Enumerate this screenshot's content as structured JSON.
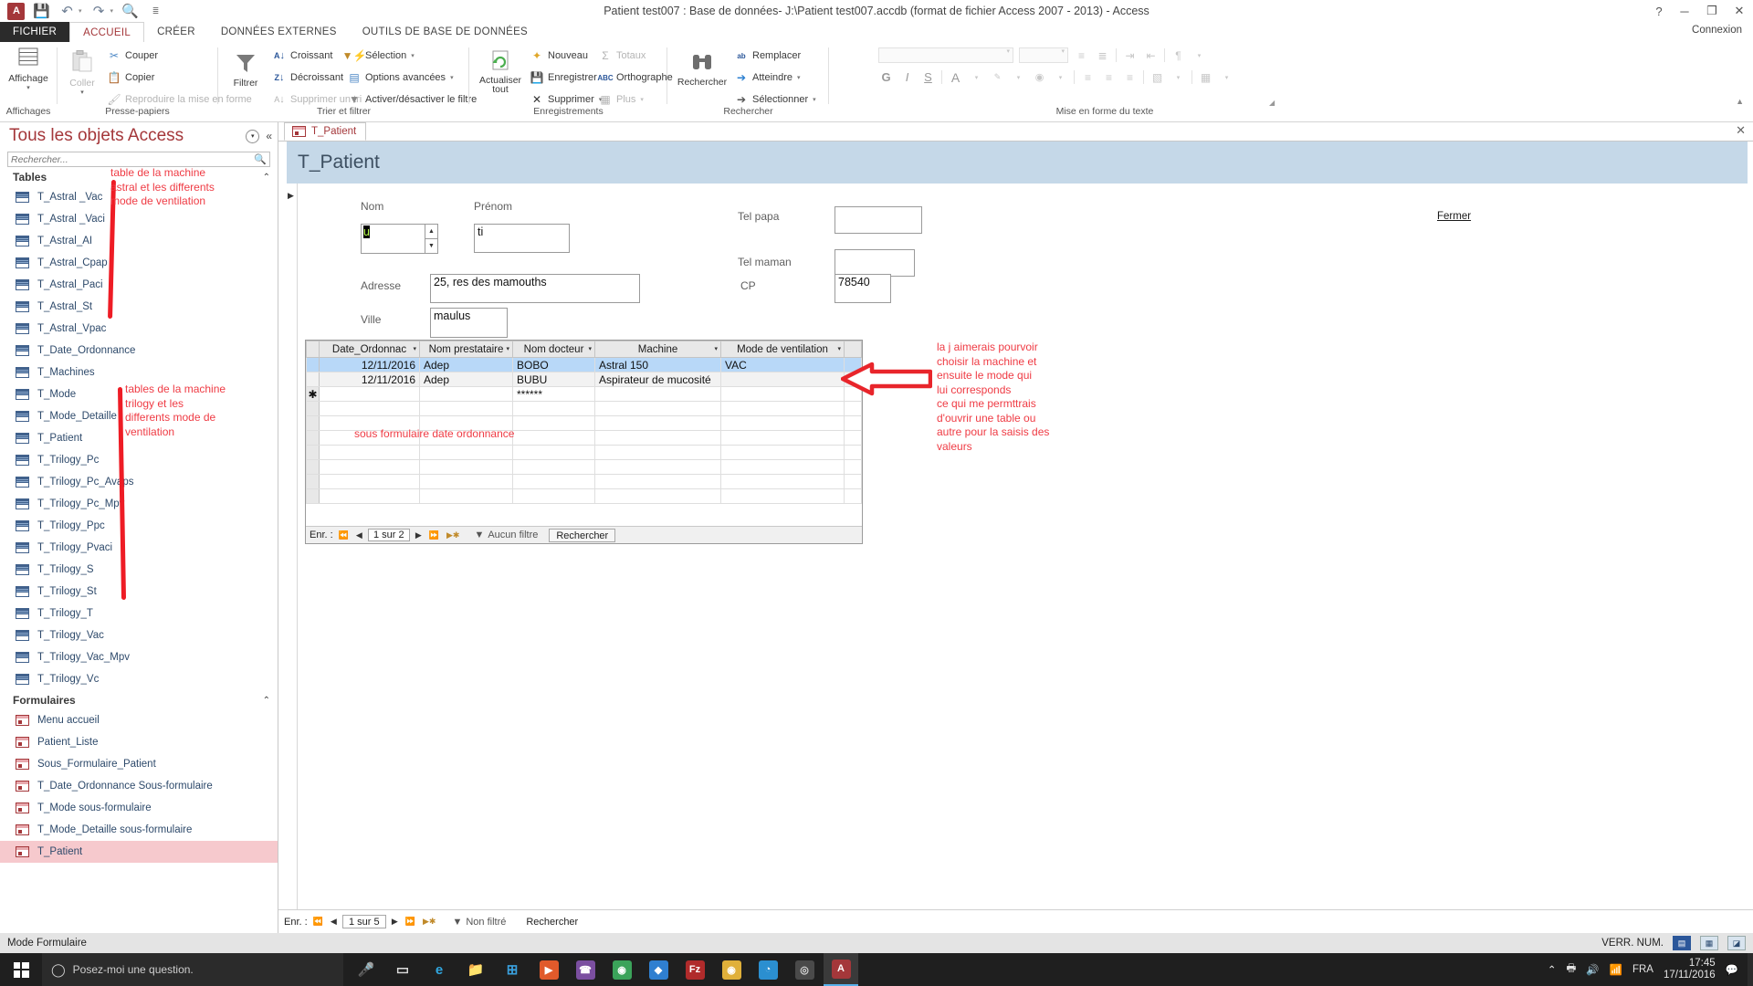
{
  "titlebar": {
    "document_title": "Patient test007 : Base de données- J:\\Patient test007.accdb (format de fichier Access 2007 - 2013) - Access",
    "qat": [
      {
        "name": "access-app-icon",
        "glyph": "A"
      },
      {
        "name": "save-icon",
        "glyph": "💾"
      },
      {
        "name": "undo-icon",
        "glyph": "↶"
      },
      {
        "name": "redo-icon",
        "glyph": "↷"
      },
      {
        "name": "print-preview-icon",
        "glyph": "🔍"
      },
      {
        "name": "customize-qat-icon",
        "glyph": "▾"
      }
    ],
    "window_controls": {
      "help": "?",
      "minimize": "─",
      "restore": "❐",
      "close": "✕"
    }
  },
  "ribbon": {
    "tabs": [
      {
        "label": "FICHIER",
        "active": false,
        "file": true
      },
      {
        "label": "ACCUEIL",
        "active": true
      },
      {
        "label": "CRÉER",
        "active": false
      },
      {
        "label": "DONNÉES EXTERNES",
        "active": false
      },
      {
        "label": "OUTILS DE BASE DE DONNÉES",
        "active": false
      }
    ],
    "connexion": "Connexion",
    "groups": [
      {
        "name": "affichages",
        "label": "Affichages"
      },
      {
        "name": "presse-papiers",
        "label": "Presse-papiers"
      },
      {
        "name": "trier-et-filtrer",
        "label": "Trier et filtrer"
      },
      {
        "name": "enregistrements",
        "label": "Enregistrements"
      },
      {
        "name": "rechercher",
        "label": "Rechercher"
      },
      {
        "name": "mise-en-forme-du-texte",
        "label": "Mise en forme du texte"
      }
    ],
    "affichage": {
      "label": "Affichage",
      "caret": "▾"
    },
    "clipboard": {
      "coller": "Coller",
      "couper": "Couper",
      "copier": "Copier",
      "reproduire": "Reproduire la mise en forme"
    },
    "filtrer": {
      "label": "Filtrer"
    },
    "tri": {
      "croissant": "Croissant",
      "decroissant": "Décroissant",
      "supprimer_tri": "Supprimer un tri",
      "selection": "Sélection",
      "options_avancees": "Options avancées",
      "activer_filtre": "Activer/désactiver le filtre"
    },
    "enregistrements": {
      "actualiser_tout": "Actualiser tout",
      "nouveau": "Nouveau",
      "enregistrer": "Enregistrer",
      "supprimer": "Supprimer",
      "totaux": "Totaux",
      "orthographe": "Orthographe",
      "plus": "Plus"
    },
    "rechercher_group": {
      "rechercher": "Rechercher",
      "remplacer": "Remplacer",
      "atteindre": "Atteindre",
      "selectionner": "Sélectionner"
    },
    "mise_en_forme": {
      "font_name": "",
      "font_size": "",
      "gras": "G",
      "italique": "I",
      "souligne": "S",
      "couleur_police": "A",
      "surlignage": "ab",
      "remplissage": "◆"
    }
  },
  "navpane": {
    "title": "Tous les objets Access",
    "search_placeholder": "Rechercher...",
    "groups": [
      {
        "name": "Tables",
        "collapse_glyph": "⌃",
        "items": [
          "T_Astral _Vac",
          "T_Astral _Vaci",
          "T_Astral_AI",
          "T_Astral_Cpap",
          "T_Astral_Paci",
          "T_Astral_St",
          "T_Astral_Vpac",
          "T_Date_Ordonnance",
          "T_Machines",
          "T_Mode",
          "T_Mode_Detaille",
          "T_Patient",
          "T_Trilogy_Pc",
          "T_Trilogy_Pc_Avaps",
          "T_Trilogy_Pc_Mpv",
          "T_Trilogy_Ppc",
          "T_Trilogy_Pvaci",
          "T_Trilogy_S",
          "T_Trilogy_St",
          "T_Trilogy_T",
          "T_Trilogy_Vac",
          "T_Trilogy_Vac_Mpv",
          "T_Trilogy_Vc"
        ]
      },
      {
        "name": "Formulaires",
        "collapse_glyph": "⌃",
        "items": [
          "Menu accueil",
          "Patient_Liste",
          "Sous_Formulaire_Patient",
          "T_Date_Ordonnance Sous-formulaire",
          "T_Mode sous-formulaire",
          "T_Mode_Detaille sous-formulaire",
          "T_Patient"
        ],
        "selected": "T_Patient"
      }
    ]
  },
  "document": {
    "tab_label": "T_Patient",
    "close_glyph": "✕",
    "form_title": "T_Patient",
    "fermer_label": "Fermer",
    "fields": [
      {
        "name": "nom",
        "label": "Nom",
        "value": "u"
      },
      {
        "name": "prenom",
        "label": "Prénom",
        "value": "ti"
      },
      {
        "name": "tel-papa",
        "label": "Tel papa",
        "value": ""
      },
      {
        "name": "tel-maman",
        "label": "Tel maman",
        "value": ""
      },
      {
        "name": "adresse",
        "label": "Adresse",
        "value": "25, res des mamouths"
      },
      {
        "name": "cp",
        "label": "CP",
        "value": "78540"
      },
      {
        "name": "ville",
        "label": "Ville",
        "value": "maulus"
      }
    ],
    "datasheet": {
      "columns": [
        "Date_Ordonnac",
        "Nom prestataire",
        "Nom docteur",
        "Machine",
        "Mode de ventilation"
      ],
      "rows": [
        {
          "selected": true,
          "cells": [
            "12/11/2016",
            "Adep",
            "BOBO",
            "Astral 150",
            "VAC"
          ]
        },
        {
          "selected": false,
          "cells": [
            "12/11/2016",
            "Adep",
            "BUBU",
            "Aspirateur de mucosité",
            ""
          ]
        },
        {
          "newrow": true,
          "cells": [
            "",
            "",
            "******",
            "",
            ""
          ]
        }
      ],
      "nav": {
        "prefix": "Enr. :",
        "position": "1 sur 2",
        "filter_label": "Aucun filtre",
        "search_label": "Rechercher"
      }
    },
    "form_nav": {
      "prefix": "Enr. :",
      "position": "1 sur 5",
      "filter_label": "Non filtré",
      "search_label": "Rechercher"
    }
  },
  "annotations": [
    {
      "name": "annot-astral",
      "text": "table de la machine\nastral et les differents\nmode de ventilation"
    },
    {
      "name": "annot-trilogy",
      "text": "tables de la machine\ntrilogy et les\ndifferents mode de\nventilation"
    },
    {
      "name": "annot-sousformulaire",
      "text": "sous formulaire date ordonnance"
    },
    {
      "name": "annot-wish",
      "text": "la j aimerais pourvoir\nchoisir la machine et\nensuite le mode qui\nlui corresponds\nce qui me permttrais\nd'ouvrir une table ou\nautre pour la saisis des\nvaleurs"
    }
  ],
  "statusbar": {
    "mode": "Mode Formulaire",
    "numlock": "VERR. NUM.",
    "views": [
      {
        "name": "form-view-button",
        "glyph": "▤",
        "active": true
      },
      {
        "name": "datasheet-view-button",
        "glyph": "▦",
        "active": false
      },
      {
        "name": "design-view-button",
        "glyph": "◪",
        "active": false
      }
    ]
  },
  "taskbar": {
    "search_placeholder": "Posez-moi une question.",
    "apps": [
      {
        "name": "cortana-mic-icon",
        "glyph": "🎤",
        "color": "#dcdcdc",
        "bg": "transparent"
      },
      {
        "name": "task-view-icon",
        "glyph": "▭",
        "color": "#dcdcdc",
        "bg": "transparent"
      },
      {
        "name": "edge-icon",
        "glyph": "e",
        "color": "#30a6df",
        "bg": "transparent"
      },
      {
        "name": "file-explorer-icon",
        "glyph": "📁",
        "color": "#f3c04a",
        "bg": "transparent"
      },
      {
        "name": "store-icon",
        "glyph": "⊞",
        "color": "#3aa0dd",
        "bg": "transparent"
      },
      {
        "name": "media-player-icon",
        "glyph": "▶",
        "color": "#fff",
        "bg": "#e05a2b"
      },
      {
        "name": "viber-icon",
        "glyph": "☎",
        "color": "#fff",
        "bg": "#7b4fa0"
      },
      {
        "name": "chrome-icon",
        "glyph": "◉",
        "color": "#fff",
        "bg": "#3ba35a"
      },
      {
        "name": "dropbox-icon",
        "glyph": "◆",
        "color": "#fff",
        "bg": "#2f7fd0"
      },
      {
        "name": "filezilla-icon",
        "glyph": "Fz",
        "color": "#fff",
        "bg": "#b02b2b"
      },
      {
        "name": "chrome2-icon",
        "glyph": "◉",
        "color": "#fff",
        "bg": "#e0b03a"
      },
      {
        "name": "clock-app-icon",
        "glyph": "◔",
        "color": "#fff",
        "bg": "#2b8fd0"
      },
      {
        "name": "camera-icon",
        "glyph": "◎",
        "color": "#d8d8d8",
        "bg": "#4a4a4a"
      },
      {
        "name": "access-taskbar-icon",
        "glyph": "A",
        "color": "#fff",
        "bg": "#a4373a",
        "active": true
      }
    ],
    "tray": {
      "chevron": "⌃",
      "icons": [
        "🖨",
        "🔊",
        "📶"
      ],
      "lang": "FRA",
      "time": "17:45",
      "date": "17/11/2016",
      "notifications": "💬"
    }
  }
}
